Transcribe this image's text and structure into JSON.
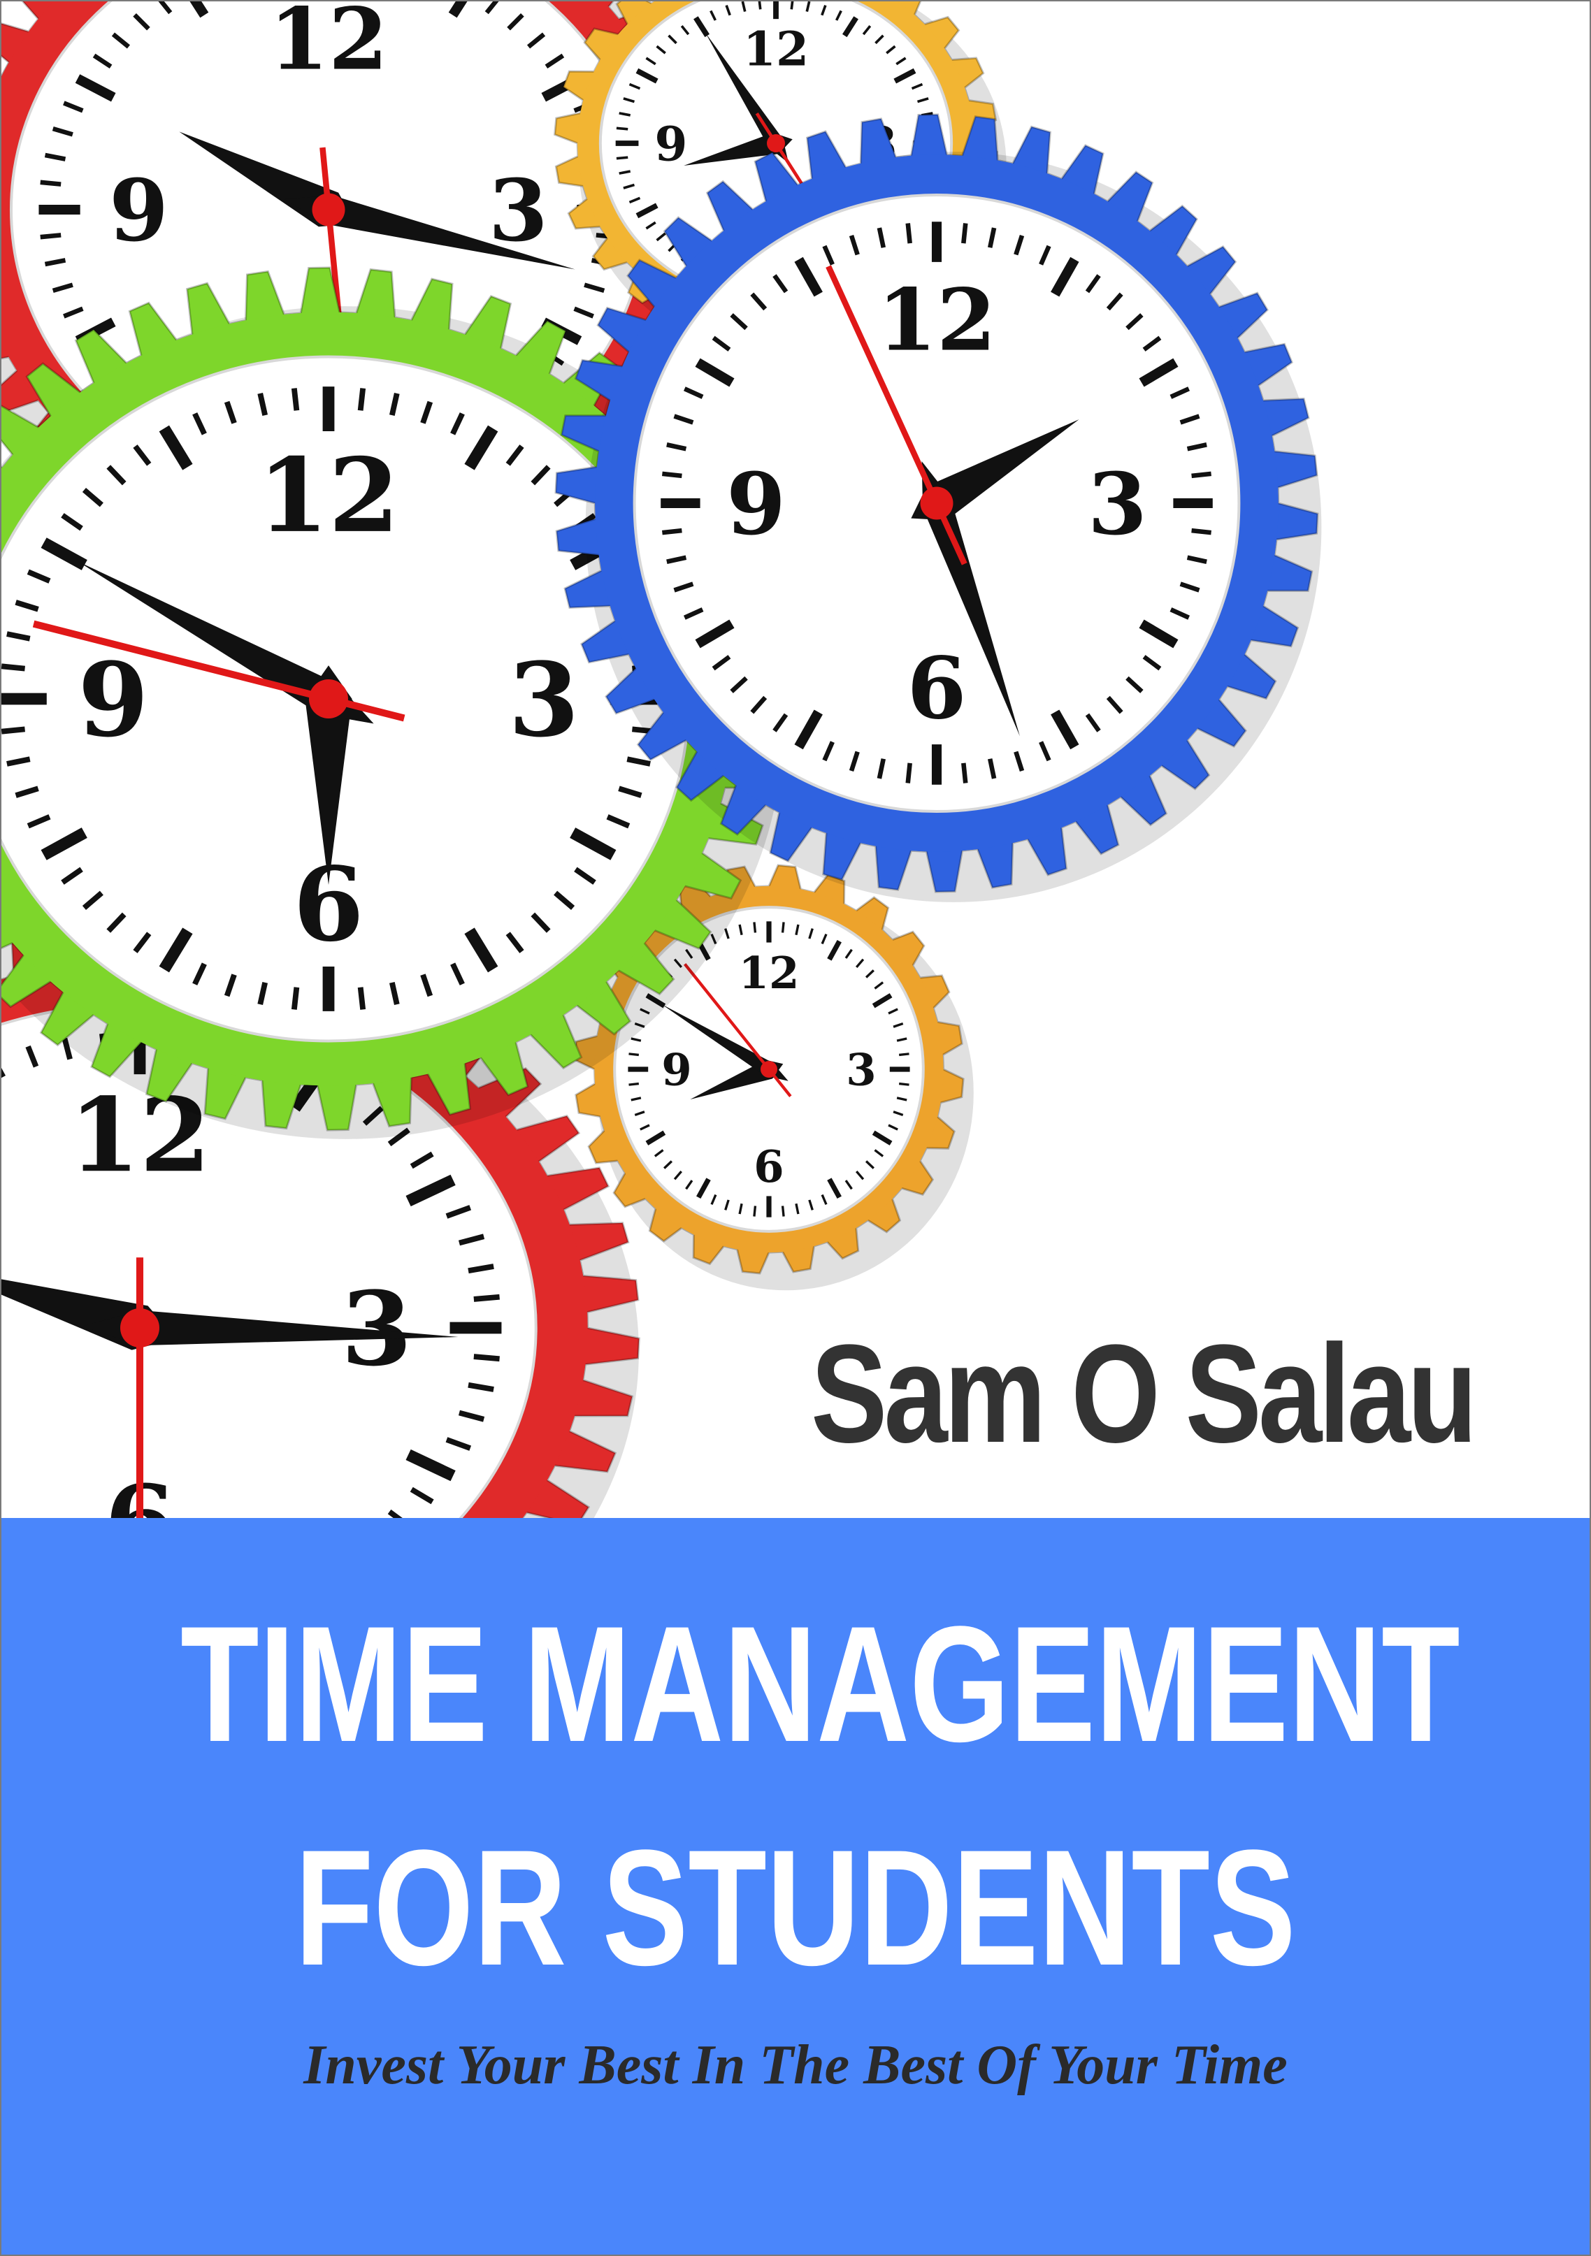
{
  "book": {
    "author": "Sam O Salau",
    "title_line1": "TIME MANAGEMENT",
    "title_line2": "FOR STUDENTS",
    "tagline": "Invest Your Best In The Best Of Your Time"
  },
  "colors": {
    "band": "#4a86fb",
    "author": "#333333",
    "title": "#ffffff",
    "tagline": "#2a2a2a",
    "gear_red": "#e02a2a",
    "gear_yellow": "#f2b533",
    "gear_blue": "#2f62e0",
    "gear_green": "#7ed62b",
    "gear_orange": "#eda32c",
    "hand_second": "#e01818"
  },
  "clock_faces": {
    "numerals": [
      "12",
      "3",
      "6",
      "9"
    ]
  },
  "icons": [
    "clock-gear-icon"
  ]
}
